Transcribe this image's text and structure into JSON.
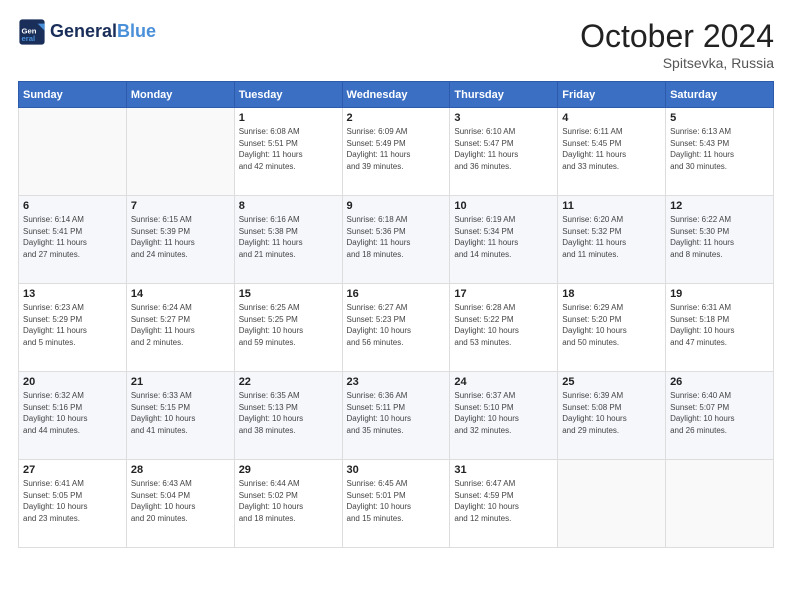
{
  "header": {
    "logo_line1": "General",
    "logo_line2": "Blue",
    "month": "October 2024",
    "location": "Spitsevka, Russia"
  },
  "days_of_week": [
    "Sunday",
    "Monday",
    "Tuesday",
    "Wednesday",
    "Thursday",
    "Friday",
    "Saturday"
  ],
  "weeks": [
    [
      {
        "num": "",
        "info": ""
      },
      {
        "num": "",
        "info": ""
      },
      {
        "num": "1",
        "info": "Sunrise: 6:08 AM\nSunset: 5:51 PM\nDaylight: 11 hours\nand 42 minutes."
      },
      {
        "num": "2",
        "info": "Sunrise: 6:09 AM\nSunset: 5:49 PM\nDaylight: 11 hours\nand 39 minutes."
      },
      {
        "num": "3",
        "info": "Sunrise: 6:10 AM\nSunset: 5:47 PM\nDaylight: 11 hours\nand 36 minutes."
      },
      {
        "num": "4",
        "info": "Sunrise: 6:11 AM\nSunset: 5:45 PM\nDaylight: 11 hours\nand 33 minutes."
      },
      {
        "num": "5",
        "info": "Sunrise: 6:13 AM\nSunset: 5:43 PM\nDaylight: 11 hours\nand 30 minutes."
      }
    ],
    [
      {
        "num": "6",
        "info": "Sunrise: 6:14 AM\nSunset: 5:41 PM\nDaylight: 11 hours\nand 27 minutes."
      },
      {
        "num": "7",
        "info": "Sunrise: 6:15 AM\nSunset: 5:39 PM\nDaylight: 11 hours\nand 24 minutes."
      },
      {
        "num": "8",
        "info": "Sunrise: 6:16 AM\nSunset: 5:38 PM\nDaylight: 11 hours\nand 21 minutes."
      },
      {
        "num": "9",
        "info": "Sunrise: 6:18 AM\nSunset: 5:36 PM\nDaylight: 11 hours\nand 18 minutes."
      },
      {
        "num": "10",
        "info": "Sunrise: 6:19 AM\nSunset: 5:34 PM\nDaylight: 11 hours\nand 14 minutes."
      },
      {
        "num": "11",
        "info": "Sunrise: 6:20 AM\nSunset: 5:32 PM\nDaylight: 11 hours\nand 11 minutes."
      },
      {
        "num": "12",
        "info": "Sunrise: 6:22 AM\nSunset: 5:30 PM\nDaylight: 11 hours\nand 8 minutes."
      }
    ],
    [
      {
        "num": "13",
        "info": "Sunrise: 6:23 AM\nSunset: 5:29 PM\nDaylight: 11 hours\nand 5 minutes."
      },
      {
        "num": "14",
        "info": "Sunrise: 6:24 AM\nSunset: 5:27 PM\nDaylight: 11 hours\nand 2 minutes."
      },
      {
        "num": "15",
        "info": "Sunrise: 6:25 AM\nSunset: 5:25 PM\nDaylight: 10 hours\nand 59 minutes."
      },
      {
        "num": "16",
        "info": "Sunrise: 6:27 AM\nSunset: 5:23 PM\nDaylight: 10 hours\nand 56 minutes."
      },
      {
        "num": "17",
        "info": "Sunrise: 6:28 AM\nSunset: 5:22 PM\nDaylight: 10 hours\nand 53 minutes."
      },
      {
        "num": "18",
        "info": "Sunrise: 6:29 AM\nSunset: 5:20 PM\nDaylight: 10 hours\nand 50 minutes."
      },
      {
        "num": "19",
        "info": "Sunrise: 6:31 AM\nSunset: 5:18 PM\nDaylight: 10 hours\nand 47 minutes."
      }
    ],
    [
      {
        "num": "20",
        "info": "Sunrise: 6:32 AM\nSunset: 5:16 PM\nDaylight: 10 hours\nand 44 minutes."
      },
      {
        "num": "21",
        "info": "Sunrise: 6:33 AM\nSunset: 5:15 PM\nDaylight: 10 hours\nand 41 minutes."
      },
      {
        "num": "22",
        "info": "Sunrise: 6:35 AM\nSunset: 5:13 PM\nDaylight: 10 hours\nand 38 minutes."
      },
      {
        "num": "23",
        "info": "Sunrise: 6:36 AM\nSunset: 5:11 PM\nDaylight: 10 hours\nand 35 minutes."
      },
      {
        "num": "24",
        "info": "Sunrise: 6:37 AM\nSunset: 5:10 PM\nDaylight: 10 hours\nand 32 minutes."
      },
      {
        "num": "25",
        "info": "Sunrise: 6:39 AM\nSunset: 5:08 PM\nDaylight: 10 hours\nand 29 minutes."
      },
      {
        "num": "26",
        "info": "Sunrise: 6:40 AM\nSunset: 5:07 PM\nDaylight: 10 hours\nand 26 minutes."
      }
    ],
    [
      {
        "num": "27",
        "info": "Sunrise: 6:41 AM\nSunset: 5:05 PM\nDaylight: 10 hours\nand 23 minutes."
      },
      {
        "num": "28",
        "info": "Sunrise: 6:43 AM\nSunset: 5:04 PM\nDaylight: 10 hours\nand 20 minutes."
      },
      {
        "num": "29",
        "info": "Sunrise: 6:44 AM\nSunset: 5:02 PM\nDaylight: 10 hours\nand 18 minutes."
      },
      {
        "num": "30",
        "info": "Sunrise: 6:45 AM\nSunset: 5:01 PM\nDaylight: 10 hours\nand 15 minutes."
      },
      {
        "num": "31",
        "info": "Sunrise: 6:47 AM\nSunset: 4:59 PM\nDaylight: 10 hours\nand 12 minutes."
      },
      {
        "num": "",
        "info": ""
      },
      {
        "num": "",
        "info": ""
      }
    ]
  ]
}
